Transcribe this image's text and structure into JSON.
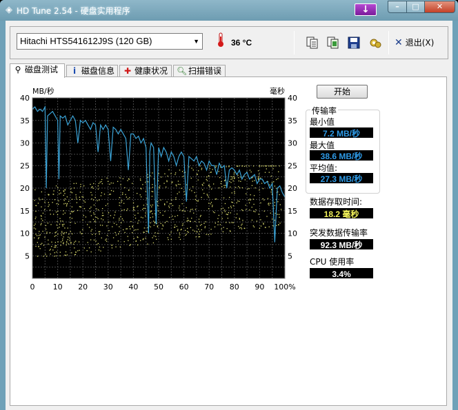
{
  "window": {
    "title": "HD Tune 2.54 - 硬盘实用程序"
  },
  "toolbar": {
    "drive": "Hitachi HTS541612J9S (120 GB)",
    "temperature": "36 °C",
    "exit_label": "退出(X)"
  },
  "tabs": [
    {
      "label": "磁盘测试",
      "icon": "benchmark-icon"
    },
    {
      "label": "磁盘信息",
      "icon": "info-icon"
    },
    {
      "label": "健康状况",
      "icon": "health-icon"
    },
    {
      "label": "扫描错误",
      "icon": "scan-icon"
    }
  ],
  "benchmark": {
    "start_label": "开始",
    "transfer_rate_title": "传输率",
    "min_label": "最小值",
    "min_value": "7.2 MB/秒",
    "max_label": "最大值",
    "max_value": "38.6 MB/秒",
    "avg_label": "平均值:",
    "avg_value": "27.3 MB/秒",
    "access_label": "数据存取时间:",
    "access_value": "18.2 毫秒",
    "burst_label": "突发数据传输率",
    "burst_value": "92.3 MB/秒",
    "cpu_label": "CPU 使用率",
    "cpu_value": "3.4%"
  },
  "chart_data": {
    "type": "line",
    "left_axis_unit": "MB/秒",
    "right_axis_unit": "毫秒",
    "ylim": [
      0,
      40
    ],
    "yticks": [
      5,
      10,
      15,
      20,
      25,
      30,
      35,
      40
    ],
    "xlim": [
      0,
      100
    ],
    "xticks": [
      "0",
      "10",
      "20",
      "30",
      "40",
      "50",
      "60",
      "70",
      "80",
      "90",
      "100%"
    ],
    "grid": true,
    "series": [
      {
        "kind": "transfer-rate",
        "color": "#3ba4d8",
        "x": [
          0,
          1,
          2,
          3,
          4,
          5,
          5.5,
          6,
          7,
          8,
          9,
          10,
          10.5,
          11,
          12,
          13,
          14,
          15,
          16,
          17,
          18,
          19,
          20,
          21,
          22,
          23,
          24,
          25,
          26,
          27,
          28,
          29,
          30,
          31,
          32,
          33,
          34,
          35,
          36,
          37,
          38,
          39,
          40,
          41,
          42,
          43,
          44,
          45,
          46,
          46.5,
          47,
          48,
          49,
          50,
          51,
          52,
          53,
          54,
          55,
          56,
          57,
          58,
          59,
          60,
          61,
          62,
          63,
          64,
          65,
          66,
          67,
          68,
          69,
          70,
          71,
          72,
          73,
          74,
          75,
          76,
          77,
          78,
          79,
          80,
          81,
          82,
          83,
          84,
          85,
          86,
          87,
          88,
          89,
          90,
          91,
          92,
          93,
          94,
          95,
          96,
          97,
          98,
          99,
          100
        ],
        "values": [
          37.5,
          38,
          37,
          37.5,
          37,
          38,
          20,
          36,
          36.5,
          37,
          36,
          35,
          22,
          36,
          35.5,
          36,
          34,
          35,
          36,
          35,
          30,
          35,
          34.5,
          35,
          34,
          33,
          34.5,
          34,
          28,
          34,
          33,
          34,
          33,
          26,
          33.5,
          33,
          32,
          33,
          32,
          31,
          24,
          32,
          32,
          31,
          31.5,
          30,
          31,
          29,
          10,
          28,
          30,
          29,
          12,
          29,
          27,
          29,
          28,
          26,
          28,
          27,
          25,
          27,
          28,
          27,
          17,
          27,
          26.5,
          26,
          27,
          25,
          26,
          25.5,
          24,
          26,
          25,
          25,
          23,
          25.5,
          24.5,
          25,
          20,
          24,
          24.5,
          24,
          23,
          24,
          22,
          23,
          23.5,
          22,
          22.5,
          23,
          21,
          22,
          22,
          21,
          21.5,
          20,
          21,
          8,
          20,
          20.5,
          19,
          18
        ]
      },
      {
        "kind": "access-time",
        "color": "#e0e070",
        "style": "scatter",
        "approx_range": [
          5,
          25
        ]
      }
    ]
  }
}
